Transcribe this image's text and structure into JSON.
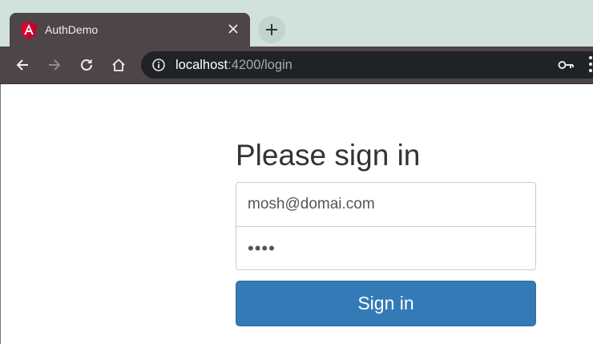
{
  "tab": {
    "title": "AuthDemo",
    "favicon": "angular-logo-icon",
    "close": "close-icon",
    "new_tab": "plus-icon"
  },
  "toolbar": {
    "back": "back-arrow-icon",
    "forward": "forward-arrow-icon",
    "reload": "reload-icon",
    "home": "home-icon",
    "url_host": "localhost",
    "url_rest": ":4200/login",
    "site_info": "info-icon",
    "password_key": "key-icon"
  },
  "form": {
    "heading": "Please sign in",
    "email_value": "mosh@domai.com",
    "password_value": "••••",
    "submit_label": "Sign in"
  },
  "colors": {
    "tabstrip": "#d1e1dc",
    "chrome_dark": "#4d4547",
    "omnibox": "#1f2326",
    "primary_button": "#337ab7"
  }
}
